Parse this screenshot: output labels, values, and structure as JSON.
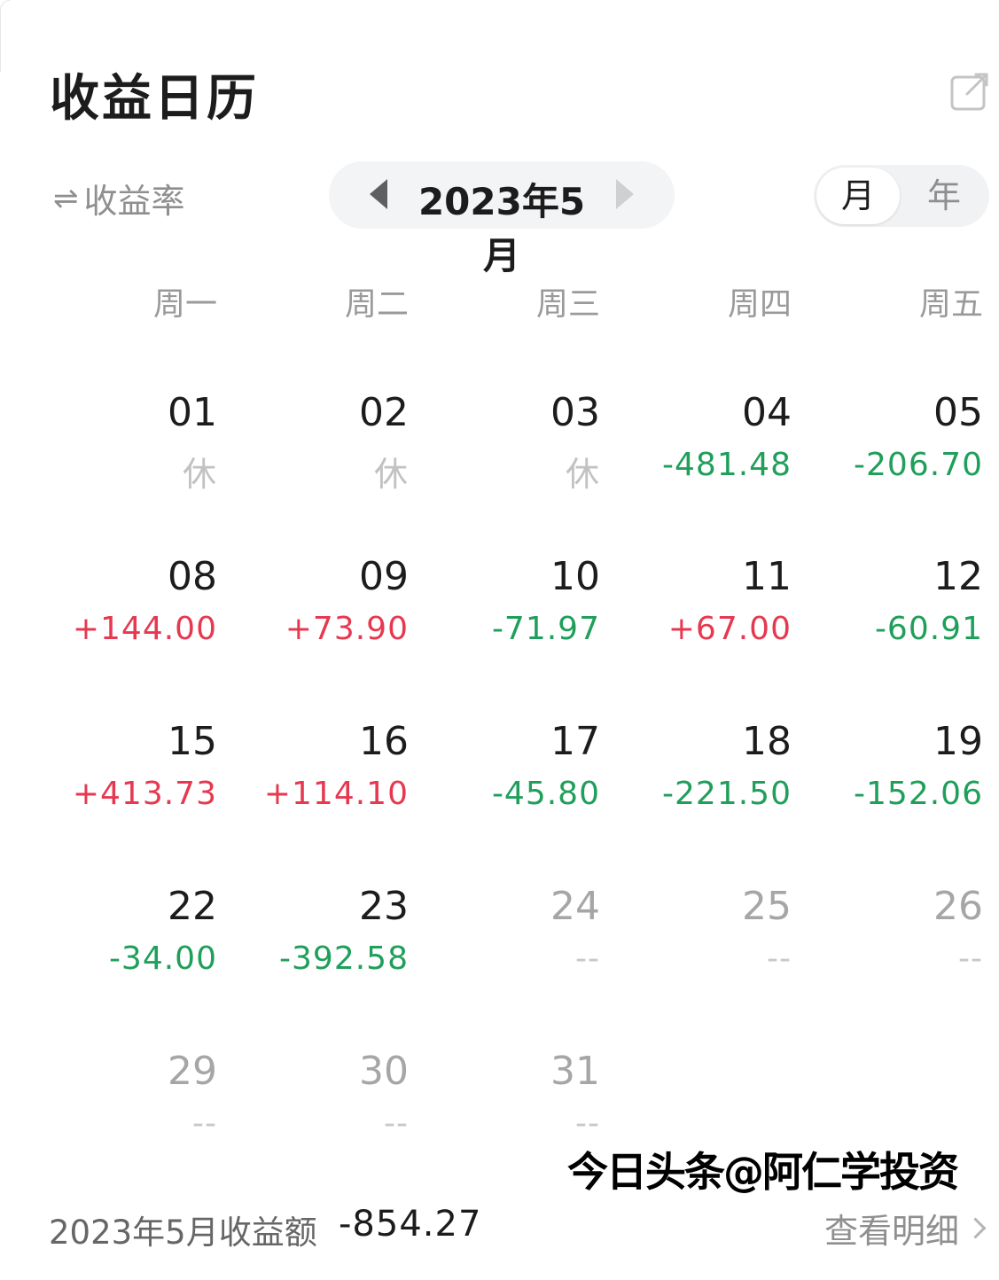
{
  "header": {
    "title": "收益日历",
    "share_icon": "share-external-icon"
  },
  "controls": {
    "rate_toggle_icon": "⇌",
    "rate_toggle_label": "收益率",
    "month_label": "2023年5月",
    "segment": {
      "month": "月",
      "year": "年",
      "selected": "月"
    }
  },
  "weekdays": [
    "周一",
    "周二",
    "周三",
    "周四",
    "周五"
  ],
  "colors": {
    "gain": "#e63950",
    "loss": "#1f9f5a",
    "muted": "#c2c2c2"
  },
  "calendar": {
    "weeks": [
      [
        {
          "day": "01",
          "value": "休",
          "kind": "rest"
        },
        {
          "day": "02",
          "value": "休",
          "kind": "rest"
        },
        {
          "day": "03",
          "value": "休",
          "kind": "rest"
        },
        {
          "day": "04",
          "value": "-481.48",
          "kind": "neg"
        },
        {
          "day": "05",
          "value": "-206.70",
          "kind": "neg"
        }
      ],
      [
        {
          "day": "08",
          "value": "+144.00",
          "kind": "pos"
        },
        {
          "day": "09",
          "value": "+73.90",
          "kind": "pos"
        },
        {
          "day": "10",
          "value": "-71.97",
          "kind": "neg"
        },
        {
          "day": "11",
          "value": "+67.00",
          "kind": "pos"
        },
        {
          "day": "12",
          "value": "-60.91",
          "kind": "neg"
        }
      ],
      [
        {
          "day": "15",
          "value": "+413.73",
          "kind": "pos"
        },
        {
          "day": "16",
          "value": "+114.10",
          "kind": "pos"
        },
        {
          "day": "17",
          "value": "-45.80",
          "kind": "neg"
        },
        {
          "day": "18",
          "value": "-221.50",
          "kind": "neg"
        },
        {
          "day": "19",
          "value": "-152.06",
          "kind": "neg"
        }
      ],
      [
        {
          "day": "22",
          "value": "-34.00",
          "kind": "neg"
        },
        {
          "day": "23",
          "value": "-392.58",
          "kind": "neg"
        },
        {
          "day": "24",
          "value": "--",
          "kind": "none"
        },
        {
          "day": "25",
          "value": "--",
          "kind": "none"
        },
        {
          "day": "26",
          "value": "--",
          "kind": "none"
        }
      ],
      [
        {
          "day": "29",
          "value": "--",
          "kind": "none"
        },
        {
          "day": "30",
          "value": "--",
          "kind": "none"
        },
        {
          "day": "31",
          "value": "--",
          "kind": "none"
        }
      ]
    ]
  },
  "watermark": "今日头条@阿仁学投资",
  "footer": {
    "total_label": "2023年5月收益额",
    "total_value": "-854.27",
    "detail_link": "查看明细"
  }
}
